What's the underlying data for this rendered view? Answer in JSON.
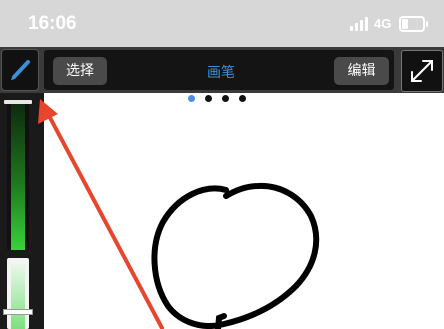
{
  "status_bar": {
    "time": "16:06",
    "network": "4G",
    "battery_level": 0.35,
    "signal_icon": "signal-bars-icon"
  },
  "toolbar": {
    "pen_tool_icon": "paintbrush-icon",
    "select_label": "选择",
    "mode_title": "画笔",
    "edit_label": "编辑",
    "expand_icon": "expand-diagonal-icon"
  },
  "page_indicator": {
    "count": 4,
    "active_index": 0
  },
  "colors": {
    "accent": "#3a8fd8",
    "arrow": "#e8452c",
    "toolbar_bg": "#141414",
    "stroke_color": "#000000"
  },
  "canvas": {
    "drawn_shape": "freehand-circle"
  }
}
